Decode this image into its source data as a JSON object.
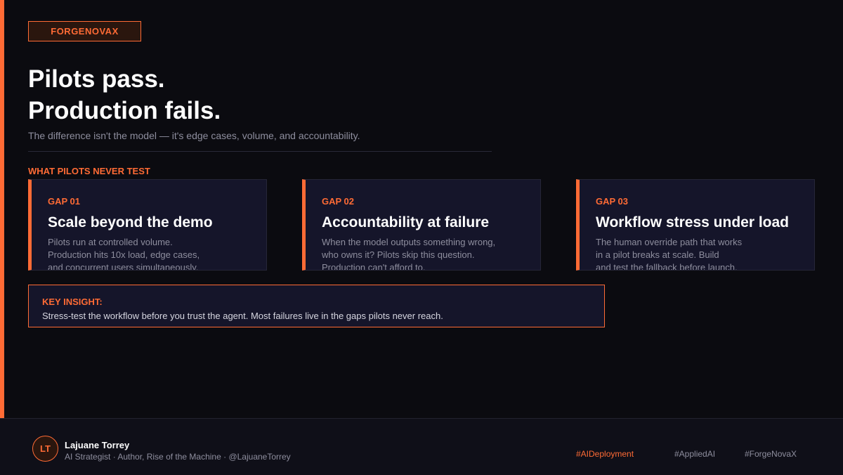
{
  "brand": {
    "tag": "FORGENOVAX"
  },
  "headline": {
    "line1": "Pilots pass.",
    "line2": "Production fails."
  },
  "subtitle": "The difference isn't the model — it's edge cases, volume, and accountability.",
  "section_label": "WHAT PILOTS NEVER TEST",
  "gaps": [
    {
      "kicker": "GAP 01",
      "title": "Scale beyond the demo",
      "body": [
        "Pilots run at controlled volume.",
        "Production hits 10x load, edge cases,",
        "and concurrent users simultaneously."
      ]
    },
    {
      "kicker": "GAP 02",
      "title": "Accountability at failure",
      "body": [
        "When the model outputs something wrong,",
        "who owns it? Pilots skip this question.",
        "Production can't afford to."
      ]
    },
    {
      "kicker": "GAP 03",
      "title": "Workflow stress under load",
      "body": [
        "The human override path that works",
        "in a pilot breaks at scale. Build",
        "and test the fallback before launch."
      ]
    }
  ],
  "insight": {
    "label": "KEY INSIGHT:",
    "text": "Stress-test the workflow before you trust the agent. Most failures live in the gaps pilots never reach."
  },
  "footer": {
    "initials": "LT",
    "name": "Lajuane Torrey",
    "meta": "AI Strategist · Author, Rise of the Machine · @LajuaneTorrey",
    "hashtags": [
      "#AIDeployment",
      "#AppliedAI",
      "#ForgeNovaX"
    ]
  },
  "colors": {
    "accent": "#ff6b35",
    "background": "#0b0b10",
    "card": "#15152a",
    "muted": "#8e8e9e"
  }
}
